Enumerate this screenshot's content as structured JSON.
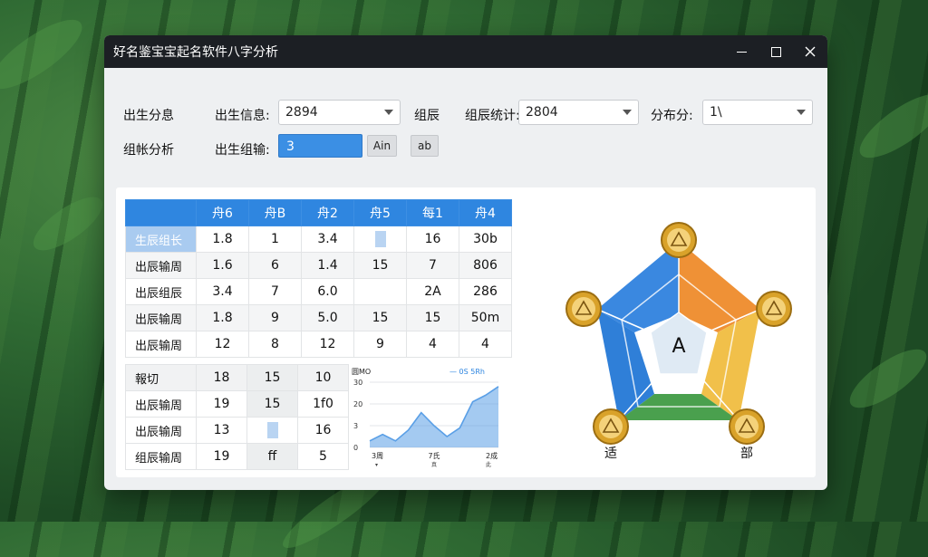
{
  "window": {
    "title": "好名鉴宝宝起名软件八字分析"
  },
  "form": {
    "row1_label": "出生分息",
    "birth_info_label": "出生信息:",
    "birth_info_value": "2894",
    "col_label": "组辰",
    "group_label": "组辰统计:",
    "group_value": "2804",
    "score_label": "分布分:",
    "score_value": "1\\",
    "row2_label": "组帐分析",
    "birth_input_label": "出生组输:",
    "birth_input_value": "3",
    "btn1_label": "Ain",
    "btn2_label": "ab"
  },
  "table_main": {
    "headers": [
      "舟6",
      "舟B",
      "舟2",
      "舟5",
      "每1",
      "舟4"
    ],
    "rows": [
      {
        "label": "生辰组长",
        "cells": [
          "1.8",
          "1",
          "3.4",
          "",
          "16",
          "30b"
        ]
      },
      {
        "label": "出辰输周",
        "cells": [
          "1.6",
          "6",
          "1.4",
          "15",
          "7",
          "806"
        ]
      },
      {
        "label": "出辰组辰",
        "cells": [
          "3.4",
          "7",
          "6.0",
          "",
          "2A",
          "286"
        ]
      },
      {
        "label": "出辰输周",
        "cells": [
          "1.8",
          "9",
          "5.0",
          "15",
          "15",
          "50m"
        ]
      },
      {
        "label": "出辰输周",
        "cells": [
          "12",
          "8",
          "12",
          "9",
          "4",
          "4"
        ]
      }
    ]
  },
  "table_small": {
    "rows": [
      {
        "label": "報切",
        "cells": [
          "18",
          "15",
          "10"
        ]
      },
      {
        "label": "出辰输周",
        "cells": [
          "19",
          "15",
          "1f0"
        ]
      },
      {
        "label": "出辰输周",
        "cells": [
          "13",
          "",
          "16"
        ]
      },
      {
        "label": "组辰输周",
        "cells": [
          "19",
          "ff",
          "5"
        ]
      }
    ]
  },
  "chart_data": {
    "type": "area",
    "title": "圆MO",
    "legend": "— 0S 5Rh",
    "y_ticks": [
      "30",
      "20",
      "3",
      "0"
    ],
    "x_labels": [
      "3周",
      "7氏",
      "2成"
    ],
    "x_sublabels": [
      "▾",
      "真",
      "此"
    ],
    "x": [
      0,
      1,
      2,
      3,
      4,
      5,
      6,
      7,
      8,
      9,
      10
    ],
    "values": [
      3,
      6,
      3,
      8,
      16,
      10,
      5,
      9,
      21,
      24,
      28
    ],
    "ylim": [
      0,
      30
    ],
    "color": "#5a9fe6"
  },
  "radar": {
    "center_label": "A",
    "bottom_left_label": "适",
    "bottom_right_label": "部",
    "colors": {
      "blue": "#3a88e0",
      "orange": "#ef9136",
      "yellow": "#f1c04a",
      "green": "#4aa04e",
      "badge": "#d9a22a"
    }
  }
}
